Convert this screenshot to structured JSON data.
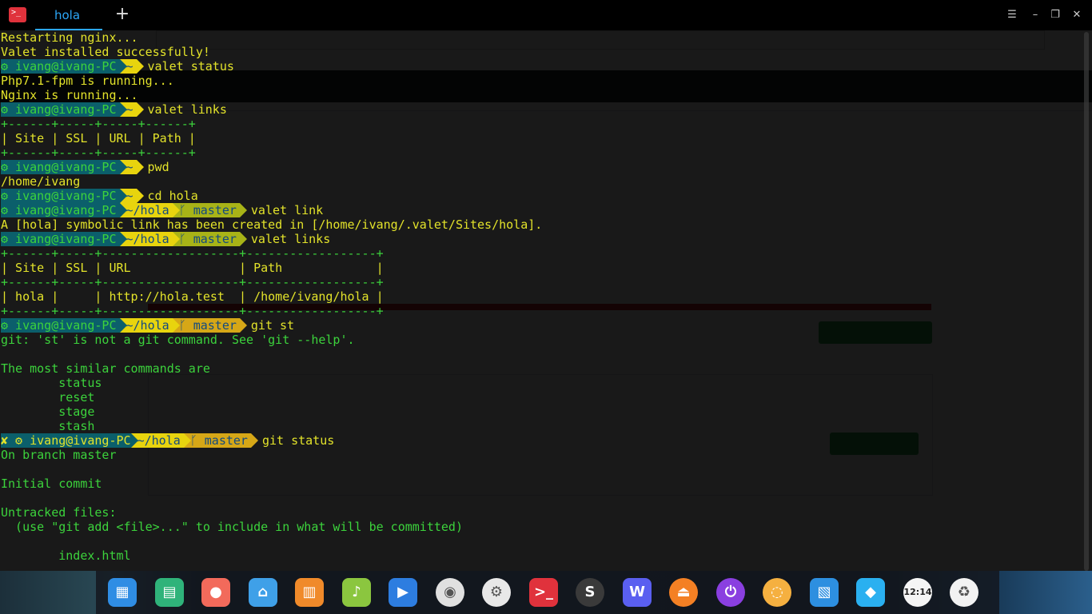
{
  "window": {
    "tab_title": "hola",
    "new_tab_icon": "plus-icon",
    "controls": [
      "menu-icon",
      "minimize-icon",
      "maximize-icon",
      "close-icon"
    ]
  },
  "colors": {
    "prompt_user_bg": "#0b5f6b",
    "prompt_dir_bg": "#e8d40e",
    "prompt_git_bg": "#a8b317",
    "prompt_git_dirty_bg": "#d6a717",
    "text_green": "#3cd33c",
    "text_yellow": "#e3e32a",
    "accent_blue": "#2ca7f8"
  },
  "terminal": {
    "lines": {
      "l1": "Restarting nginx...",
      "l2": "Valet installed successfully!",
      "p3_user": "⚙ ivang@ivang-PC",
      "p3_dir": "~",
      "p3_cmd": "valet status",
      "l4": "Php7.1-fpm is running...",
      "l5": "Nginx is running...",
      "p6_user": "⚙ ivang@ivang-PC",
      "p6_dir": "~",
      "p6_cmd": "valet links",
      "l7": "+------+-----+-----+------+",
      "l8": "| Site | SSL | URL | Path |",
      "l9": "+------+-----+-----+------+",
      "p10_user": "⚙ ivang@ivang-PC",
      "p10_dir": "~",
      "p10_cmd": "pwd",
      "l11": "/home/ivang",
      "p12_user": "⚙ ivang@ivang-PC",
      "p12_dir": "~",
      "p12_cmd": "cd hola",
      "p13_user": "⚙ ivang@ivang-PC",
      "p13_dir": "~/hola",
      "p13_git": "ᚴ master",
      "p13_cmd": "valet link",
      "l14": "A [hola] symbolic link has been created in [/home/ivang/.valet/Sites/hola].",
      "p15_user": "⚙ ivang@ivang-PC",
      "p15_dir": "~/hola",
      "p15_git": "ᚴ master",
      "p15_cmd": "valet links",
      "l16": "+------+-----+-------------------+------------------+",
      "l17": "| Site | SSL | URL               | Path             |",
      "l18": "+------+-----+-------------------+------------------+",
      "l19": "| hola |     | http://hola.test  | /home/ivang/hola |",
      "l20": "+------+-----+-------------------+------------------+",
      "p21_user": "⚙ ivang@ivang-PC",
      "p21_dir": "~/hola",
      "p21_git": "ᚴ master",
      "p21_cmd": "git st",
      "l22": "git: 'st' is not a git command. See 'git --help'.",
      "l23": "",
      "l24": "The most similar commands are",
      "l25": "        status",
      "l26": "        reset",
      "l27": "        stage",
      "l28": "        stash",
      "p29_user": "✘ ⚙ ivang@ivang-PC",
      "p29_dir": "~/hola",
      "p29_git": "ᚴ master",
      "p29_cmd": "git status",
      "l30": "On branch master",
      "l31": "",
      "l32": "Initial commit",
      "l33": "",
      "l34": "Untracked files:",
      "l35": "  (use \"git add <file>...\" to include in what will be committed)",
      "l36": "",
      "l37": "        index.html"
    }
  },
  "dock": {
    "items": [
      {
        "name": "launcher",
        "icon": "grid-icon",
        "color": "#2f8de4",
        "glyph": "▦"
      },
      {
        "name": "file-manager",
        "icon": "folder-icon",
        "color": "#2fb37a",
        "glyph": "▤"
      },
      {
        "name": "screen-recorder",
        "icon": "video-icon",
        "color": "#f26a5b",
        "glyph": "●"
      },
      {
        "name": "store",
        "icon": "store-icon",
        "color": "#3fa0e8",
        "glyph": "⌂"
      },
      {
        "name": "package-manager",
        "icon": "package-icon",
        "color": "#f08a2a",
        "glyph": "▥"
      },
      {
        "name": "music",
        "icon": "music-icon",
        "color": "#8bc63f",
        "glyph": "♪"
      },
      {
        "name": "movie",
        "icon": "film-icon",
        "color": "#2d7de0",
        "glyph": "▶"
      },
      {
        "name": "chrome",
        "icon": "chrome-icon",
        "color": "#e0e0e0",
        "glyph": "◉"
      },
      {
        "name": "settings",
        "icon": "gear-icon",
        "color": "#e8e8e8",
        "glyph": "⚙"
      },
      {
        "name": "terminal",
        "icon": "terminal-icon",
        "color": "#e0323c",
        "glyph": ">_"
      },
      {
        "name": "sublime",
        "icon": "sublime-icon",
        "color": "#3a3a3a",
        "glyph": "S"
      },
      {
        "name": "webstorm",
        "icon": "webstorm-icon",
        "color": "#5a5ff0",
        "glyph": "W"
      },
      {
        "name": "eject",
        "icon": "eject-icon",
        "color": "#f48024",
        "glyph": "⏏"
      },
      {
        "name": "power",
        "icon": "power-icon",
        "color": "#8a3fe0",
        "glyph": "⏻"
      },
      {
        "name": "update",
        "icon": "update-icon",
        "color": "#f5b040",
        "glyph": "◌"
      },
      {
        "name": "screenshot",
        "icon": "screenshot-icon",
        "color": "#2d8fe0",
        "glyph": "▧"
      },
      {
        "name": "network",
        "icon": "wifi-icon",
        "color": "#2ab0f0",
        "glyph": "◆"
      },
      {
        "name": "clock",
        "icon": "clock-icon",
        "color": "#f5f5f5",
        "glyph": "12:14"
      },
      {
        "name": "trash",
        "icon": "trash-icon",
        "color": "#f2f2f2",
        "glyph": "♻"
      }
    ]
  }
}
